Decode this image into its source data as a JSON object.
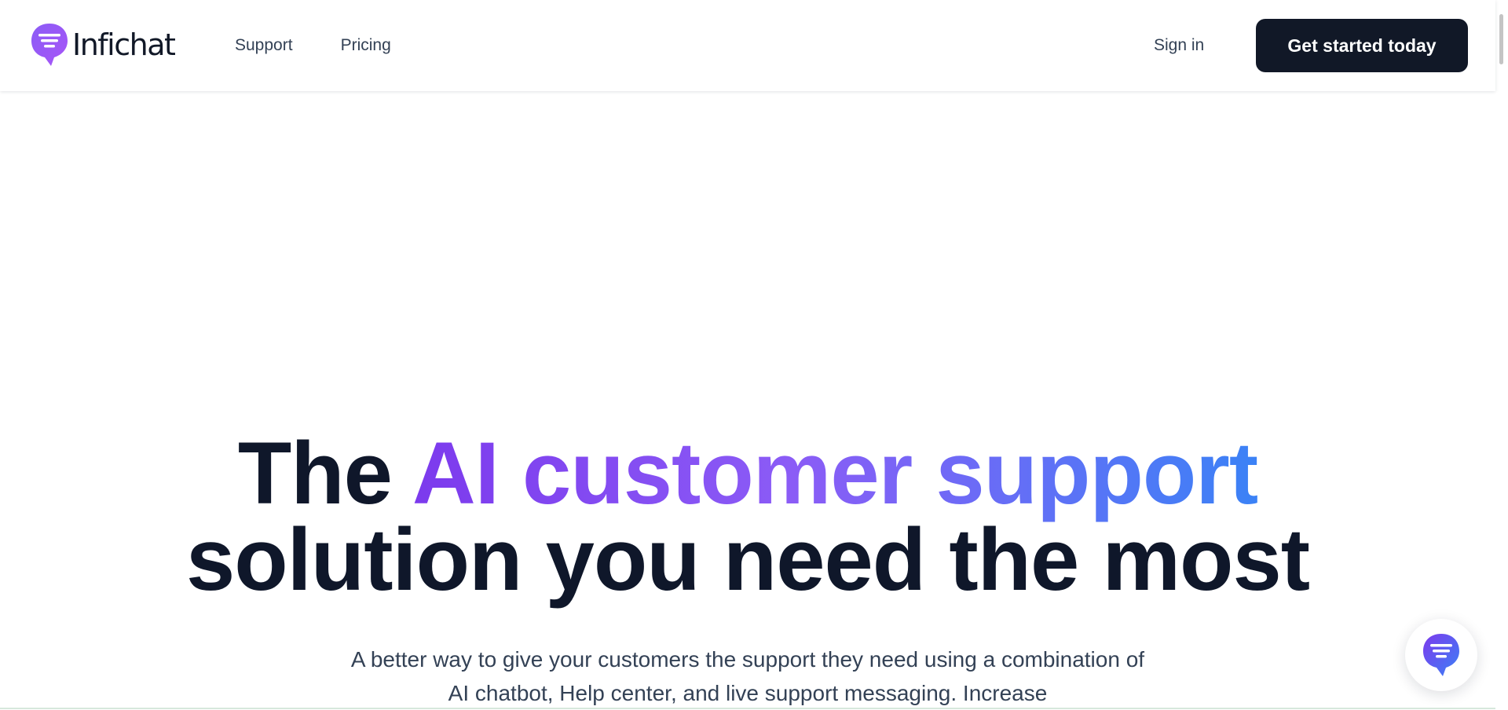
{
  "brand": {
    "name": "Infichat"
  },
  "nav": {
    "items": [
      {
        "label": "Support"
      },
      {
        "label": "Pricing"
      }
    ]
  },
  "auth": {
    "sign_in_label": "Sign in",
    "cta_label": "Get started today"
  },
  "hero": {
    "title_part1": "The",
    "title_highlight": "AI customer support",
    "title_line2": "solution you need the most",
    "subtitle": "A better way to give your customers the support they need using a combination of AI chatbot, Help center, and live support messaging. Increase"
  },
  "icons": {
    "logo": "chat-bubble-logo-icon",
    "chat_launcher": "chat-bubble-icon"
  },
  "colors": {
    "accent_start": "#7c3aed",
    "accent_end": "#3b82f6",
    "cta_background": "#111827"
  }
}
